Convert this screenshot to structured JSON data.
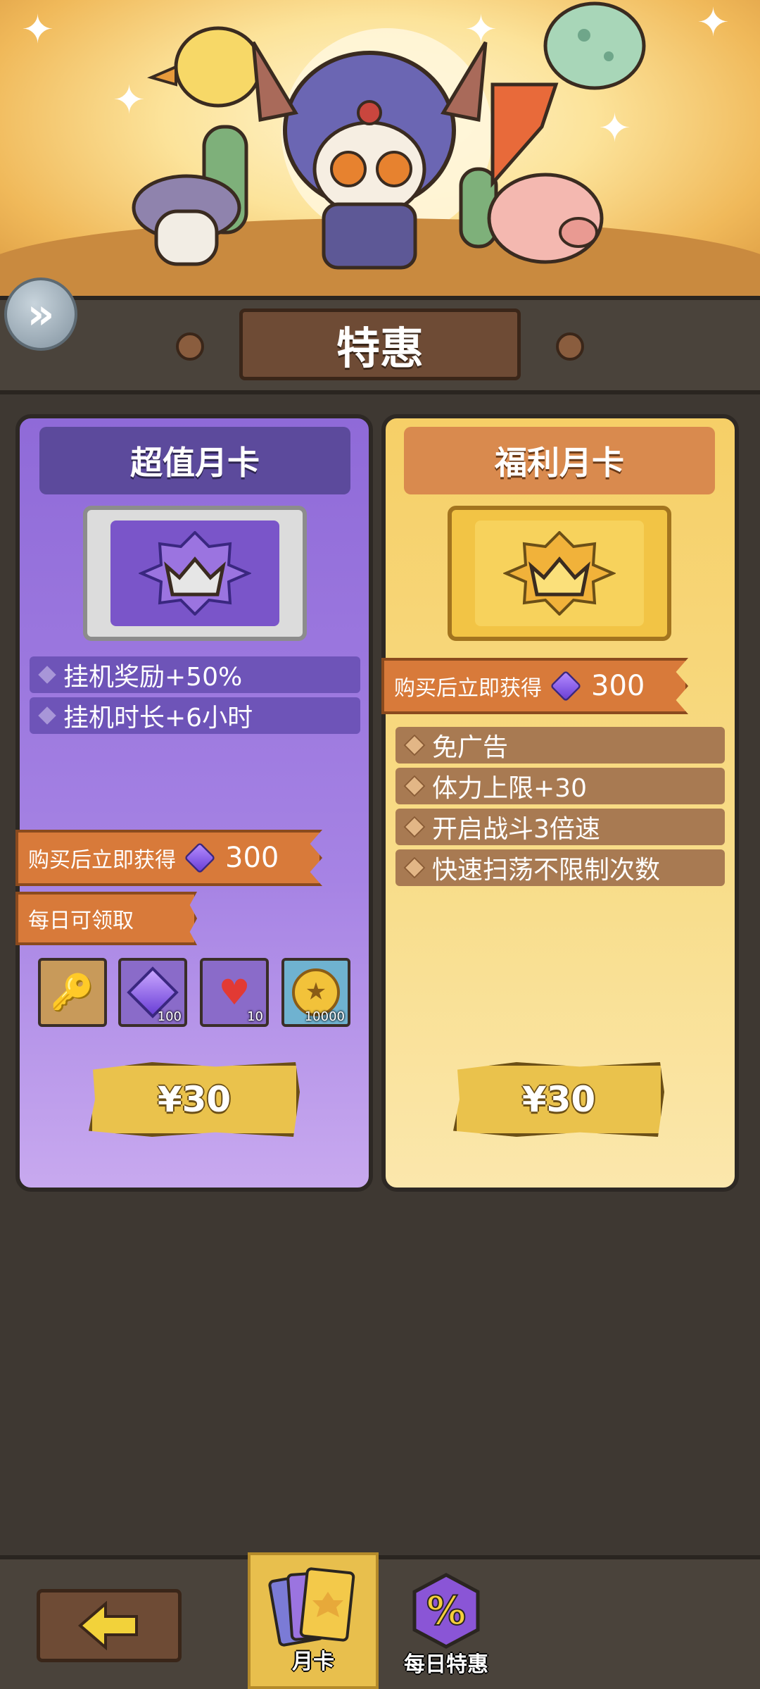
{
  "header": {
    "title": "特惠",
    "expand_icon": "double-chevron-right"
  },
  "cards": [
    {
      "id": "super",
      "title": "超值月卡",
      "perks": [
        "挂机奖励+50%",
        "挂机时长+6小时"
      ],
      "instant_reward": {
        "label": "购买后立即获得",
        "amount": "300"
      },
      "daily_label": "每日可领取",
      "daily_rewards": [
        {
          "icon": "key-icon",
          "qty": ""
        },
        {
          "icon": "gem-icon",
          "qty": "100"
        },
        {
          "icon": "heart-icon",
          "qty": "10"
        },
        {
          "icon": "coin-icon",
          "qty": "10000"
        }
      ],
      "price": "¥30",
      "color": "#9a74de"
    },
    {
      "id": "welfare",
      "title": "福利月卡",
      "instant_reward": {
        "label": "购买后立即获得",
        "amount": "300"
      },
      "perks": [
        "免广告",
        "体力上限+30",
        "开启战斗3倍速",
        "快速扫荡不限制次数"
      ],
      "price": "¥30",
      "color": "#f6cf67"
    }
  ],
  "bottom_nav": {
    "back_icon": "arrow-left-icon",
    "tabs": [
      {
        "label": "月卡",
        "active": true,
        "icon": "card-stack-icon"
      },
      {
        "label": "每日特惠",
        "active": false,
        "icon": "percent-icon"
      }
    ]
  }
}
